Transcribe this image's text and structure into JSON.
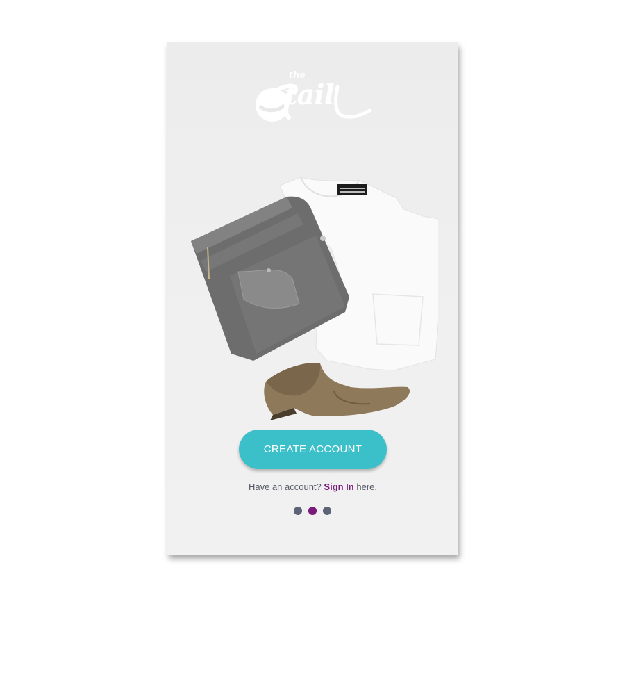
{
  "logo": {
    "prefix": "the",
    "word": "tail"
  },
  "hero": {
    "icon": "clothing-flatlay-image"
  },
  "cta": {
    "label": "CREATE ACCOUNT"
  },
  "signin": {
    "prefix": "Have an account?",
    "link": "Sign In",
    "suffix": "here."
  },
  "pagination": {
    "total": 3,
    "active_index": 1
  },
  "colors": {
    "accent": "#3bbfc9",
    "brand": "#7b1a7a",
    "dot_inactive": "#5e6478"
  }
}
